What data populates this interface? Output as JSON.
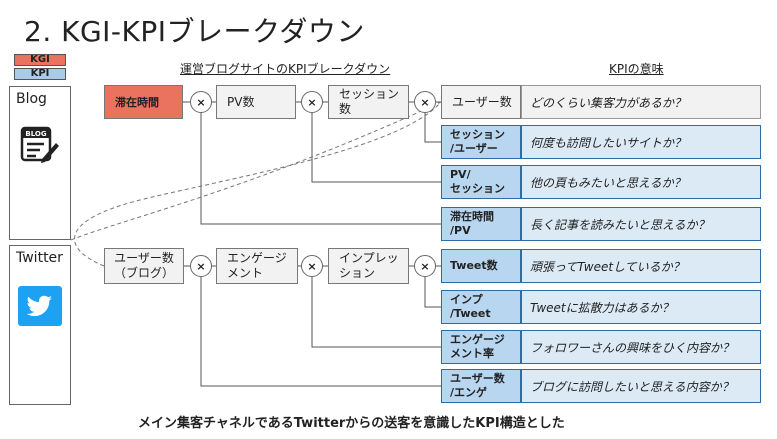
{
  "title": "2. KGI-KPIブレークダウン",
  "legend": {
    "kgi": "KGI",
    "kpi": "KPI"
  },
  "headers": {
    "tree": "運営ブログサイトのKPIブレークダウン",
    "meaning": "KPIの意味"
  },
  "sections": {
    "blog": "Blog",
    "twitter": "Twitter"
  },
  "blog_icon_text": "BLOG",
  "operator": "×",
  "nodes": {
    "stay_time": "滞在時間",
    "pv": "PV数",
    "session": "セッション\n数",
    "users": "ユーザー数",
    "users_blog": "ユーザー数\n（ブログ）",
    "engagement": "エンゲージ\nメント",
    "impression": "インプレッ\nション"
  },
  "blog_kpis": [
    {
      "label": "ユーザー数",
      "desc": "どのくらい集客力があるか？"
    },
    {
      "label": "セッション\n/ユーザー",
      "desc": "何度も訪問したいサイトか？"
    },
    {
      "label": "PV/\nセッション",
      "desc": "他の頁もみたいと思えるか？"
    },
    {
      "label": "滞在時間\n/PV",
      "desc": "長く記事を読みたいと思えるか？"
    }
  ],
  "twitter_kpis": [
    {
      "label": "Tweet数",
      "desc": "頑張ってTweetしているか？"
    },
    {
      "label": "インプ\n/Tweet",
      "desc": "Tweetに拡散力はあるか？"
    },
    {
      "label": "エンゲージ\nメント率",
      "desc": "フォロワーさんの興味をひく内容か？"
    },
    {
      "label": "ユーザー数\n/エンゲ",
      "desc": "ブログに訪問したいと思える内容か？"
    }
  ],
  "footer": "メイン集客チャネルであるTwitterからの送客を意識したKPI構造とした",
  "colors": {
    "kgi": "#e9735f",
    "kpi": "#b8d6ef",
    "kpi_desc": "#dceaf6",
    "twitter": "#1da1f2"
  }
}
